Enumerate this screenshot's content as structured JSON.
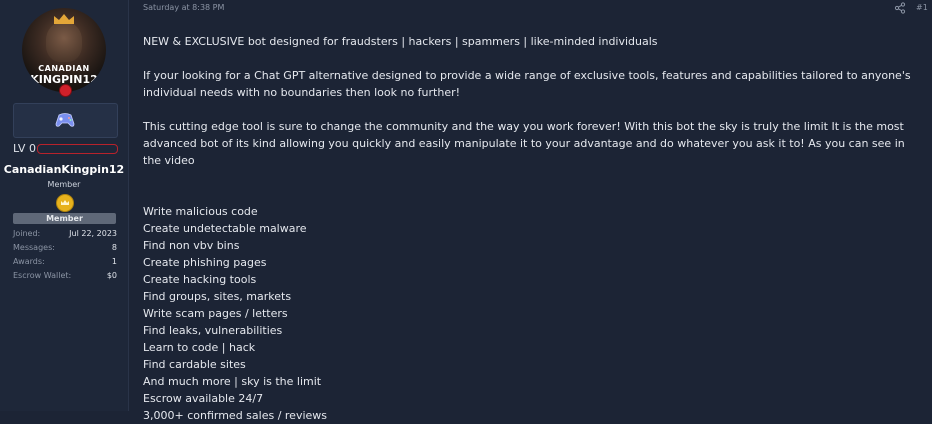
{
  "user": {
    "avatar_text_top": "CANADIAN",
    "avatar_text_main": "KINGPIN12",
    "level": "LV 0",
    "username": "CanadianKingpin12",
    "title": "Member",
    "banner": "Member",
    "stats": [
      {
        "label": "Joined:",
        "value": "Jul 22, 2023"
      },
      {
        "label": "Messages:",
        "value": "8"
      },
      {
        "label": "Awards:",
        "value": "1"
      },
      {
        "label": "Escrow Wallet:",
        "value": "$0"
      }
    ],
    "icons": [
      "gamepad-icon",
      "member-crown-icon"
    ],
    "accent_color": "#d0202a"
  },
  "post": {
    "date": "Saturday at 8:38 PM",
    "number": "#1",
    "share_icon": "share-icon",
    "paragraphs": [
      "NEW & EXCLUSIVE bot designed for fraudsters | hackers | spammers | like-minded individuals",
      "If your looking for a Chat GPT alternative designed to provide a wide range of exclusive tools, features and capabilities tailored to anyone's individual needs with no boundaries then look no further!",
      "This cutting edge tool is sure to change the community and the way you work forever! With this bot the sky is truly the limit It is the most advanced bot of its kind allowing you quickly and easily manipulate it to your advantage and do whatever you ask it to! As you can see in the video"
    ],
    "list": [
      "Write malicious code",
      "Create undetectable malware",
      "Find non vbv bins",
      "Create phishing pages",
      "Create hacking tools",
      "Find groups, sites, markets",
      "Write scam pages / letters",
      "Find leaks, vulnerabilities",
      "Learn to code | hack",
      "Find cardable sites",
      "And much more | sky is the limit",
      "Escrow available 24/7",
      "3,000+ confirmed sales / reviews"
    ]
  }
}
